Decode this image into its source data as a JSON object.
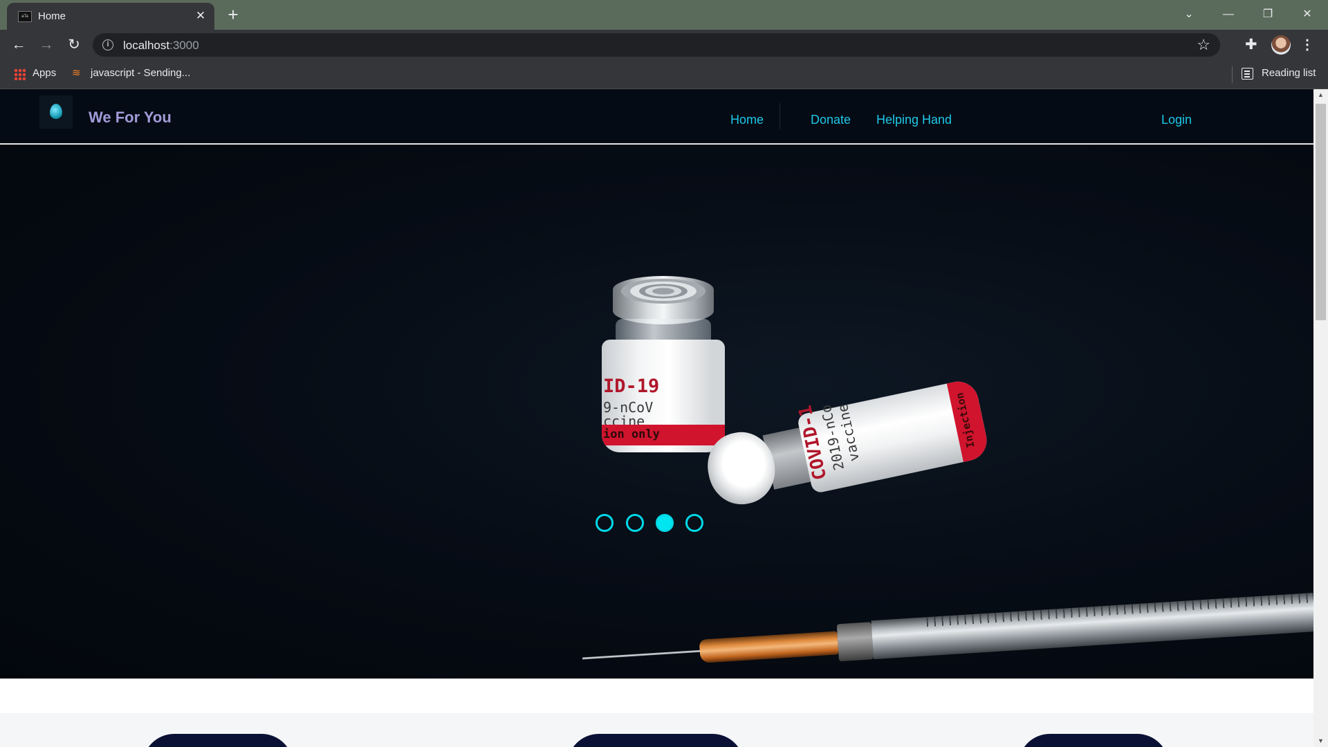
{
  "browser": {
    "tab_title": "Home",
    "tab_favicon_text": "aTa",
    "url_host": "localhost",
    "url_port": ":3000",
    "bookmarks": [
      {
        "label": "Apps"
      },
      {
        "label": "javascript - Sending..."
      }
    ],
    "reading_list_label": "Reading list"
  },
  "site": {
    "brand": "We For You",
    "nav": [
      {
        "label": "Home"
      },
      {
        "label": "Donate"
      },
      {
        "label": "Helping Hand"
      }
    ],
    "login_label": "Login"
  },
  "hero": {
    "vial1_lines": [
      "ID-19",
      "9-nCoV",
      "ccine",
      "ion only"
    ],
    "vial2_lines": [
      "COVID-1",
      "2019-nCo",
      "vaccine"
    ],
    "vial2_band": "Injection",
    "indicators": [
      {
        "active": false
      },
      {
        "active": false
      },
      {
        "active": true
      },
      {
        "active": false
      }
    ],
    "active_slide": 3,
    "slide_count": 4
  },
  "colors": {
    "nav_link": "#1ec8e8",
    "brand": "#a29bd8",
    "indicator": "#00e5f0",
    "navbar_bg": "#050b14"
  }
}
